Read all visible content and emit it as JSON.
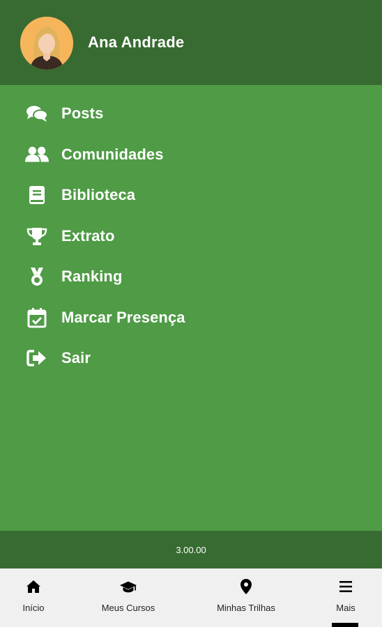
{
  "colors": {
    "header": "#376b31",
    "menu_bg": "#4f9b46",
    "nav_bg": "#f0f0f0",
    "avatar_bg": "#f7b55b"
  },
  "header": {
    "user_name": "Ana Andrade",
    "avatar_icon": "user-avatar"
  },
  "menu": {
    "items": [
      {
        "label": "Posts",
        "icon": "comments-icon"
      },
      {
        "label": "Comunidades",
        "icon": "users-icon"
      },
      {
        "label": "Biblioteca",
        "icon": "book-icon"
      },
      {
        "label": "Extrato",
        "icon": "trophy-icon"
      },
      {
        "label": "Ranking",
        "icon": "medal-icon"
      },
      {
        "label": "Marcar Presença",
        "icon": "calendar-check-icon"
      },
      {
        "label": "Sair",
        "icon": "sign-out-icon"
      }
    ]
  },
  "footer": {
    "version": "3.00.00"
  },
  "bottom_nav": {
    "items": [
      {
        "label": "Início",
        "icon": "home-icon"
      },
      {
        "label": "Meus Cursos",
        "icon": "graduation-cap-icon"
      },
      {
        "label": "Minhas Trilhas",
        "icon": "map-marker-icon"
      },
      {
        "label": "Mais",
        "icon": "menu-icon",
        "active": true
      }
    ]
  }
}
